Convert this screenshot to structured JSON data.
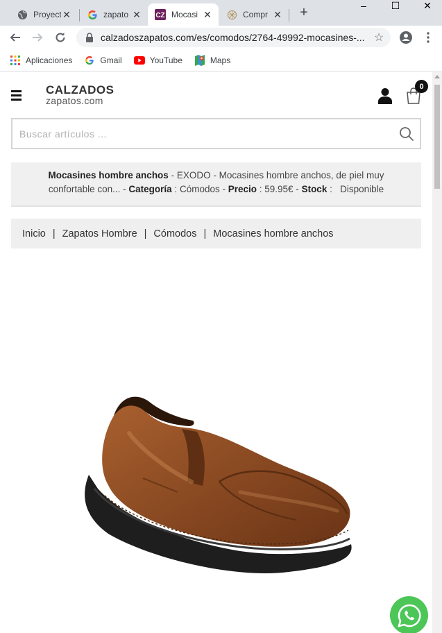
{
  "browser": {
    "tabs": [
      {
        "title": "Proyect",
        "icon": "globe-icon",
        "active": false
      },
      {
        "title": "zapato",
        "icon": "google-icon",
        "active": false
      },
      {
        "title": "Mocasi",
        "icon": "cz-favicon",
        "active": true
      },
      {
        "title": "Compr",
        "icon": "wheel-icon",
        "active": false
      }
    ],
    "url": "calzadoszapatos.com/es/comodos/2764-49992-mocasines-...",
    "bookmarks": [
      {
        "label": "Aplicaciones",
        "icon": "apps-grid-icon"
      },
      {
        "label": "Gmail",
        "icon": "google-icon"
      },
      {
        "label": "YouTube",
        "icon": "youtube-icon"
      },
      {
        "label": "Maps",
        "icon": "maps-icon"
      }
    ]
  },
  "site": {
    "logo_line1": "CALZADOS",
    "logo_line2": "zapatos.com",
    "cart_count": "0",
    "search_placeholder": "Buscar artículos ..."
  },
  "product_info": {
    "name": "Mocasines hombre anchos",
    "desc_sep1": " - EXODO - Mocasines hombre anchos, de piel muy confortable con... - ",
    "category_label": "Categoría",
    "category_value": " : Cómodos - ",
    "price_label": "Precio",
    "price_value": " : 59.95€ - ",
    "stock_label": "Stock",
    "stock_value": " :   Disponible"
  },
  "breadcrumb": [
    {
      "label": "Inicio"
    },
    {
      "label": "Zapatos Hombre"
    },
    {
      "label": "Cómodos"
    },
    {
      "label": "Mocasines hombre anchos"
    }
  ],
  "colors": {
    "shoe_brown": "#8a4a22",
    "whatsapp_green": "#4bc657"
  }
}
